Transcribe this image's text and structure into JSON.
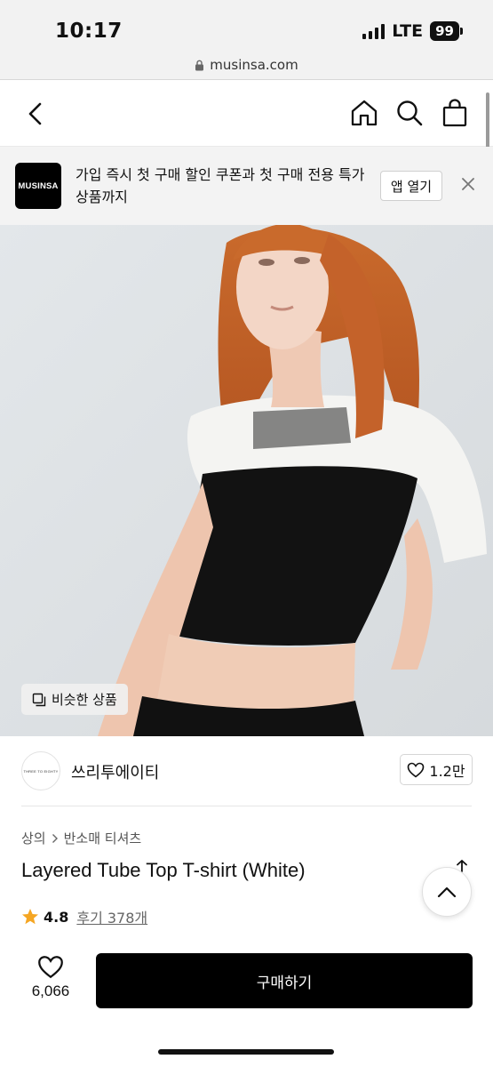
{
  "status_bar": {
    "time": "10:17",
    "network": "LTE",
    "battery": "99"
  },
  "browser": {
    "url": "musinsa.com"
  },
  "nav": {
    "back_icon": "chevron-left-icon",
    "home_icon": "home-icon",
    "search_icon": "search-icon",
    "cart_icon": "shopping-bag-icon"
  },
  "banner": {
    "logo_text": "MUSINSA",
    "message": "가입 즉시 첫 구매 할인 쿠폰과 첫 구매 전용 특가 상품까지",
    "open_app_label": "앱 열기"
  },
  "product_image": {
    "similar_button_label": "비슷한 상품"
  },
  "brand": {
    "logo_text": "THREE TO EIGHTY",
    "name": "쓰리투에이티",
    "likes": "1.2만"
  },
  "product": {
    "breadcrumb": [
      "상의",
      "반소매 티셔츠"
    ],
    "title": "Layered Tube Top T-shirt (White)",
    "rating": "4.8",
    "reviews_label": "후기 378개"
  },
  "bottom_bar": {
    "wish_count": "6,066",
    "buy_label": "구매하기"
  },
  "colors": {
    "accent_star": "#f5a623",
    "buy_button": "#000000",
    "hair": "#c8652e"
  }
}
